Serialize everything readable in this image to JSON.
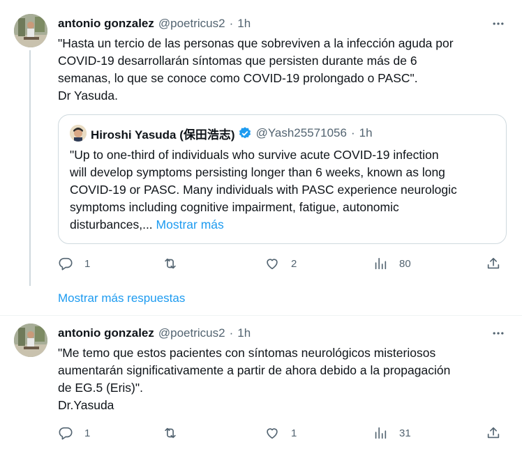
{
  "colors": {
    "accent": "#1d9bf0",
    "text": "#0f1419",
    "muted": "#536471",
    "border": "#cfd9de"
  },
  "tweets": [
    {
      "author": {
        "name": "antonio gonzalez",
        "handle": "@poetricus2",
        "separator": "·",
        "time": "1h"
      },
      "text_lines": [
        "\"Hasta un tercio de las personas que sobreviven a la infección aguda por",
        "COVID-19 desarrollarán síntomas que persisten durante más de 6",
        "semanas, lo que se conoce como COVID-19 prolongado o PASC\".",
        "Dr Yasuda."
      ],
      "quote": {
        "author": {
          "name": "Hiroshi Yasuda (保田浩志)",
          "handle": "@Yash25571056",
          "separator": "·",
          "time": "1h",
          "verified": true
        },
        "text_lines": [
          "\"Up to one-third of individuals who survive acute COVID-19 infection",
          "will develop symptoms persisting longer than 6 weeks, known as long",
          "COVID-19 or PASC. Many individuals with PASC experience neurologic",
          "symptoms including cognitive impairment, fatigue, autonomic"
        ],
        "last_line": "disturbances,...",
        "show_more": "Mostrar más"
      },
      "actions": {
        "replies": "1",
        "retweets": "",
        "likes": "2",
        "views": "80"
      }
    },
    {
      "author": {
        "name": "antonio gonzalez",
        "handle": "@poetricus2",
        "separator": "·",
        "time": "1h"
      },
      "text_lines": [
        "\"Me temo que estos pacientes con síntomas neurológicos misteriosos",
        "aumentarán significativamente a partir de ahora debido a la propagación",
        "de EG.5 (Eris)\".",
        "Dr.Yasuda"
      ],
      "actions": {
        "replies": "1",
        "retweets": "",
        "likes": "1",
        "views": "31"
      }
    }
  ],
  "show_more_replies": "Mostrar más respuestas",
  "icons": [
    "more-icon",
    "verified-icon",
    "reply-icon",
    "retweet-icon",
    "like-icon",
    "views-icon",
    "share-icon"
  ]
}
